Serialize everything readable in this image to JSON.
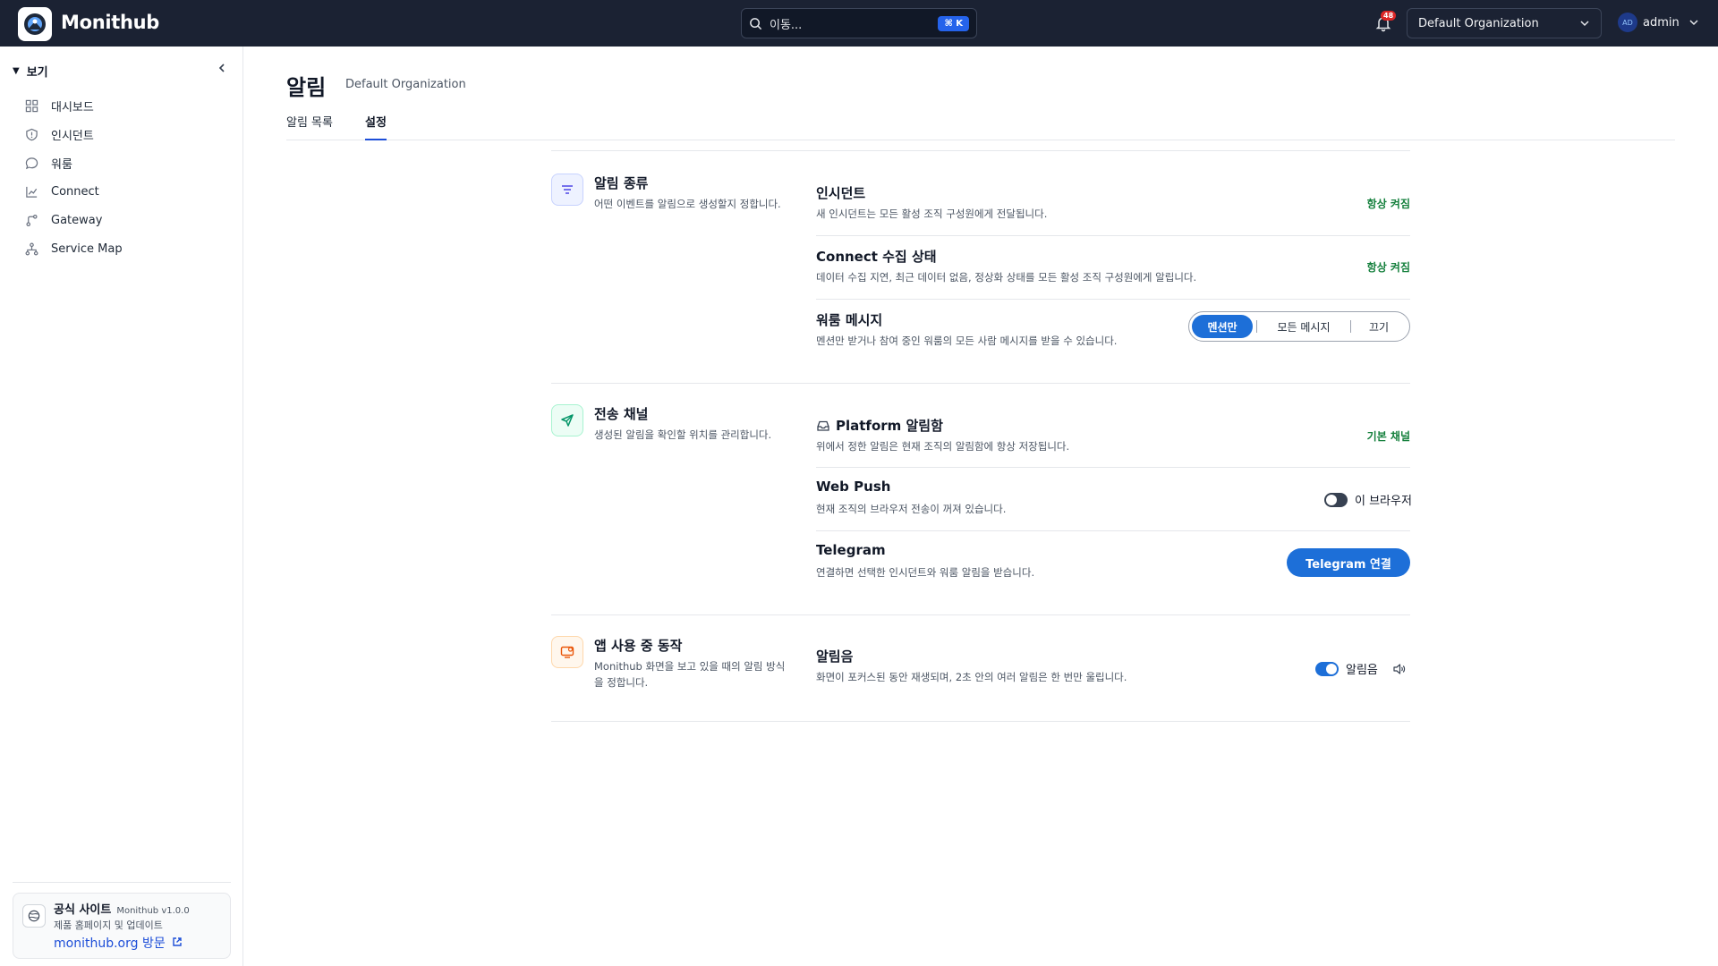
{
  "topbar": {
    "brand": "Monithub",
    "search_placeholder": "이동...",
    "search_shortcut": "⌘ K",
    "notification_count": "48",
    "org_selected": "Default Organization",
    "user_initials": "AD",
    "user_name": "admin"
  },
  "sidebar": {
    "section_label": "보기",
    "items": [
      {
        "label": "대시보드",
        "icon": "dashboard-icon"
      },
      {
        "label": "인시던트",
        "icon": "shield-icon"
      },
      {
        "label": "워룸",
        "icon": "chat-icon"
      },
      {
        "label": "Connect",
        "icon": "chart-icon"
      },
      {
        "label": "Gateway",
        "icon": "branch-icon"
      },
      {
        "label": "Service Map",
        "icon": "network-icon"
      }
    ],
    "promo": {
      "title": "공식 사이트",
      "version": "Monithub v1.0.0",
      "subtitle": "제품 홈페이지 및 업데이트",
      "link": "monithub.org 방문"
    }
  },
  "page": {
    "title": "알림",
    "org": "Default Organization",
    "tabs": [
      {
        "label": "알림 목록",
        "active": false
      },
      {
        "label": "설정",
        "active": true
      }
    ]
  },
  "sections": {
    "types": {
      "title": "알림 종류",
      "desc": "어떤 이벤트를 알림으로 생성할지 정합니다.",
      "rows": {
        "incident": {
          "title": "인시던트",
          "desc": "새 인시던트는 모든 활성 조직 구성원에게 전달됩니다.",
          "status": "항상 켜짐"
        },
        "connect": {
          "title": "Connect 수집 상태",
          "desc": "데이터 수집 지연, 최근 데이터 없음, 정상화 상태를 모든 활성 조직 구성원에게 알립니다.",
          "status": "항상 켜짐"
        },
        "warroom": {
          "title": "워룸 메시지",
          "desc": "멘션만 받거나 참여 중인 워룸의 모든 사람 메시지를 받을 수 있습니다.",
          "options": [
            "멘션만",
            "모든 메시지",
            "끄기"
          ],
          "selected": "멘션만"
        }
      }
    },
    "channels": {
      "title": "전송 채널",
      "desc": "생성된 알림을 확인할 위치를 관리합니다.",
      "rows": {
        "inbox": {
          "title": "Platform 알림함",
          "desc": "위에서 정한 알림은 현재 조직의 알림함에 항상 저장됩니다.",
          "status": "기본 채널"
        },
        "webpush": {
          "title": "Web Push",
          "desc": "현재 조직의 브라우저 전송이 꺼져 있습니다.",
          "toggle_label": "이 브라우저",
          "enabled": false
        },
        "telegram": {
          "title": "Telegram",
          "desc": "연결하면 선택한 인시던트와 워룸 알림을 받습니다.",
          "button": "Telegram 연결"
        }
      }
    },
    "inapp": {
      "title": "앱 사용 중 동작",
      "desc": "Monithub 화면을 보고 있을 때의 알림 방식을 정합니다.",
      "rows": {
        "sound": {
          "title": "알림음",
          "desc": "화면이 포커스된 동안 재생되며, 2초 안의 여러 알림은 한 번만 울립니다.",
          "toggle_label": "알림음",
          "enabled": true
        }
      }
    }
  },
  "colors": {
    "topbar_bg": "#1b2233",
    "accent": "#1d6fd8",
    "status_green": "#15803d"
  }
}
